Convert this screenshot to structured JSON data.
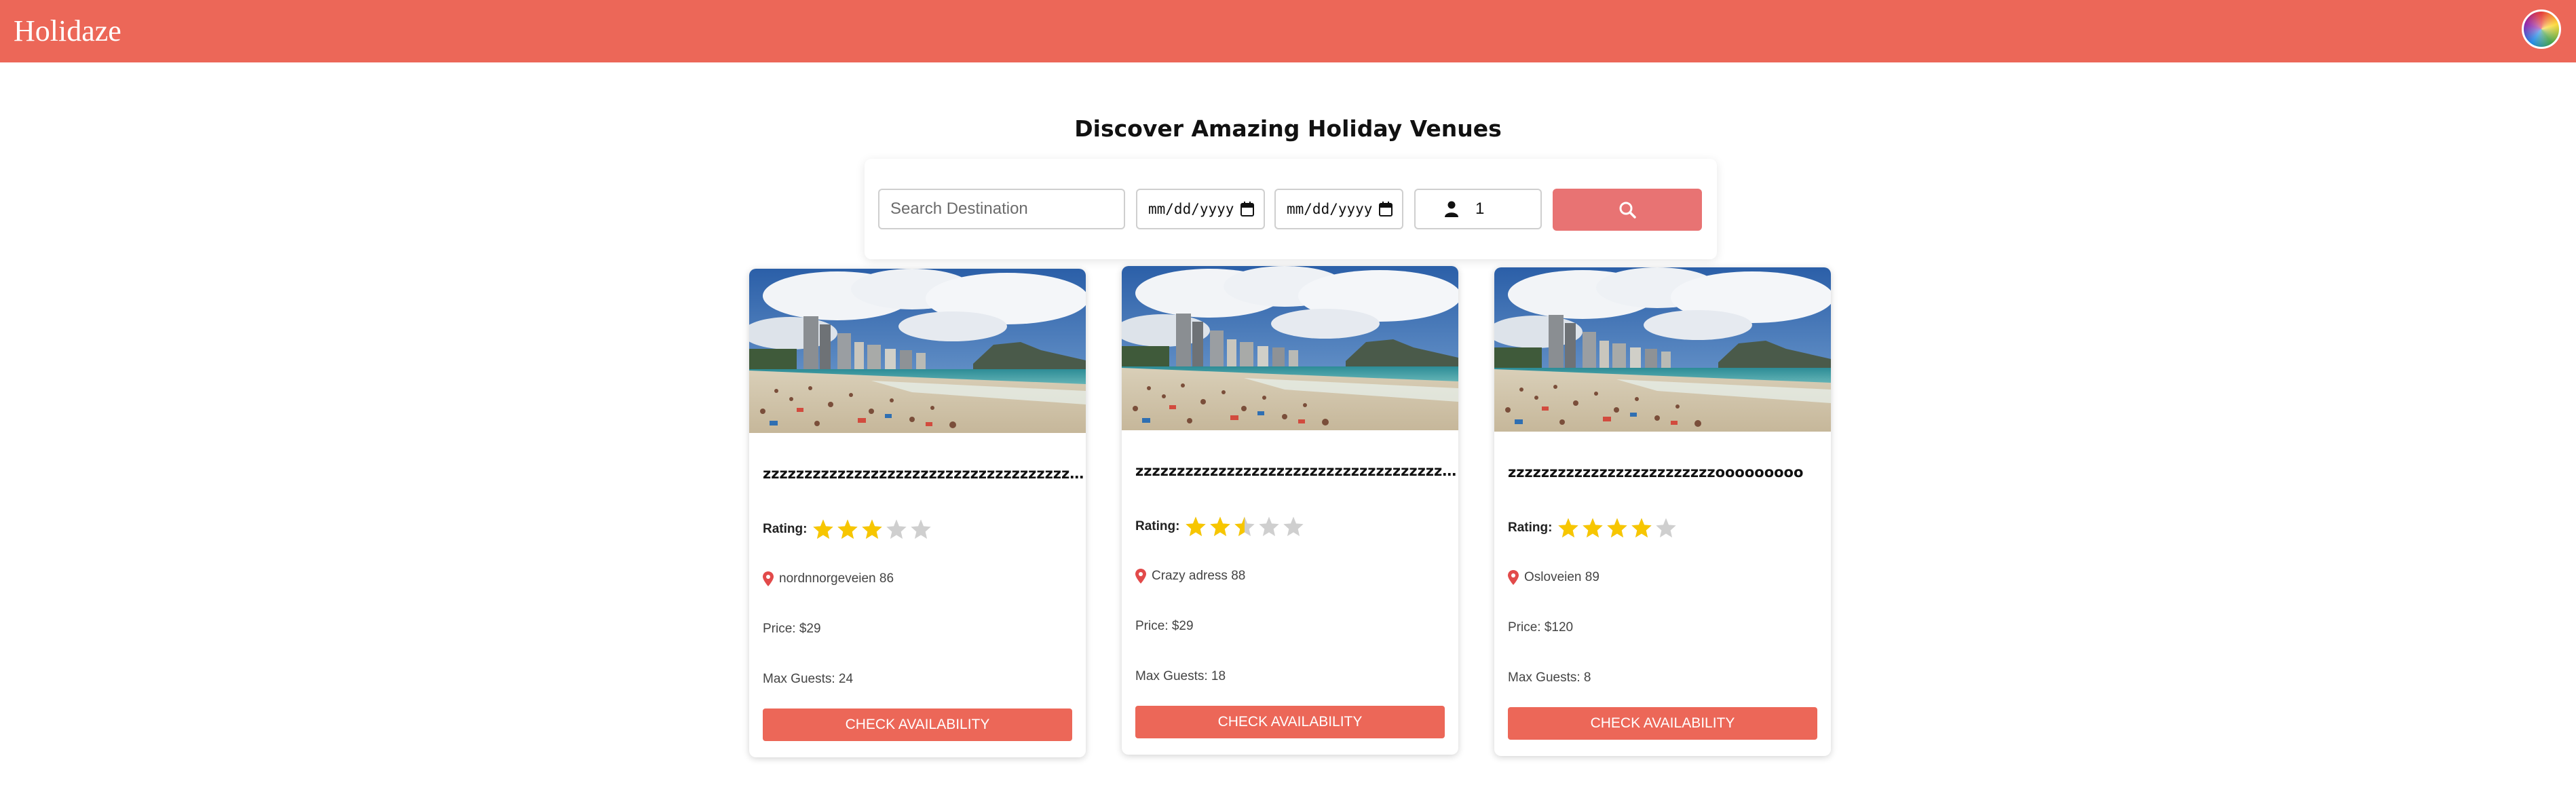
{
  "app": {
    "brand": "Holidaze",
    "accent": "#ec6758"
  },
  "header": {
    "avatar_icon": "color-wheel-avatar-icon"
  },
  "main": {
    "title": "Discover Amazing Holiday Venues"
  },
  "search": {
    "destination_placeholder": "Search Destination",
    "destination_value": "",
    "checkin_placeholder": "mm/dd/yyyy",
    "checkout_placeholder": "mm/dd/yyyy",
    "guests_value": "1",
    "button_icon": "search-icon",
    "button_color": "#e87373"
  },
  "venues": [
    {
      "title": "zzzzzzzzzzzzzzzzzzzzzzzzzzzzzzzzzzzzzzzzzzzzzzzzzz",
      "rating_label": "Rating:",
      "rating": 3,
      "address": "nordnnorgeveien 86",
      "price": "Price: $29",
      "max_guests": "Max Guests: 24",
      "button": "CHECK AVAILABILITY"
    },
    {
      "title": "zzzzzzzzzzzzzzzzzzzzzzzzzzzzzzzzzzzzzzzzzzzzzzzzzz",
      "rating_label": "Rating:",
      "rating": 2.5,
      "address": "Crazy adress 88",
      "price": "Price: $29",
      "max_guests": "Max Guests: 18",
      "button": "CHECK AVAILABILITY"
    },
    {
      "title": "zzzzzzzzzzzzzzzzzzzzzzzzzooooooooo",
      "rating_label": "Rating:",
      "rating": 4,
      "address": "Osloveien 89",
      "price": "Price: $120",
      "max_guests": "Max Guests: 8",
      "button": "CHECK AVAILABILITY"
    }
  ]
}
